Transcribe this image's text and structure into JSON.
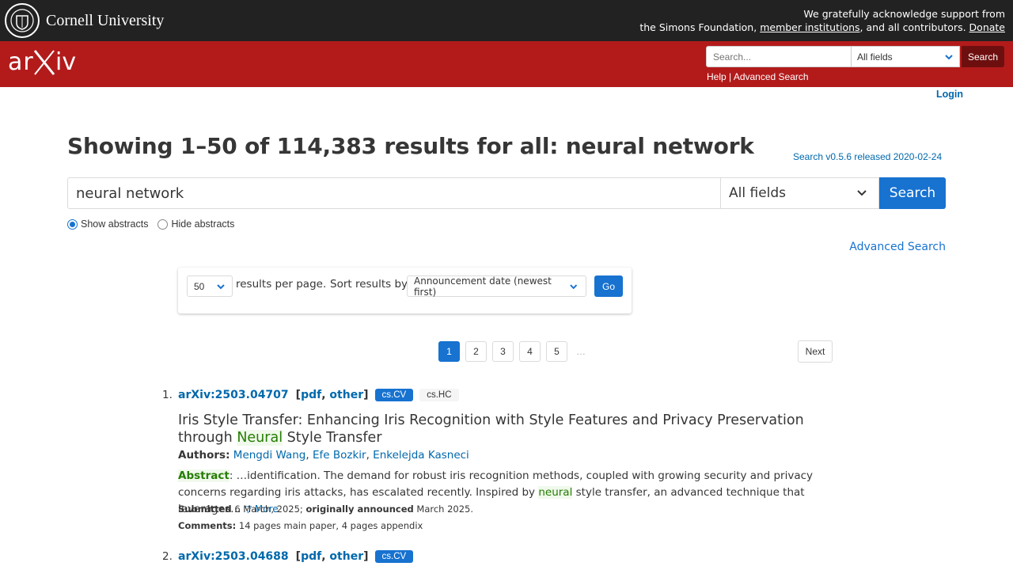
{
  "cornell": {
    "name": "Cornell University",
    "support_line1": "We gratefully acknowledge support from",
    "support_prefix": "the Simons Foundation,",
    "member_link": "member institutions",
    "support_mid": ", and all contributors.",
    "donate": "Donate"
  },
  "header": {
    "logo_text": "arXiv",
    "search_placeholder": "Search...",
    "field_value": "All fields",
    "search_button": "Search",
    "help": "Help",
    "separator": "|",
    "advanced": "Advanced Search",
    "login": "Login"
  },
  "page": {
    "title": "Showing 1–50 of 114,383 results for all: neural network",
    "version": "Search v0.5.6 released 2020-02-24",
    "query": "neural network",
    "field": "All fields",
    "search_button": "Search",
    "show_abstracts": "Show abstracts",
    "hide_abstracts": "Hide abstracts",
    "advanced_search": "Advanced Search"
  },
  "controls": {
    "per_page": "50",
    "per_page_label": "results per page.",
    "sort_label": "Sort results by",
    "sort_value": "Announcement date (newest first)",
    "go": "Go"
  },
  "pagination": {
    "pages": [
      "1",
      "2",
      "3",
      "4",
      "5"
    ],
    "ellipsis": "…",
    "next": "Next"
  },
  "results": [
    {
      "num": "1.",
      "id": "arXiv:2503.04707",
      "pdf": "pdf",
      "other": "other",
      "primary_tag": "cs.CV",
      "secondary_tag": "cs.HC",
      "title_pre": "Iris Style Transfer: Enhancing Iris Recognition with Style Features and Privacy Preservation through ",
      "title_hl": "Neural",
      "title_post": " Style Transfer",
      "authors_label": "Authors:",
      "authors": [
        "Mengdi Wang",
        "Efe Bozkir",
        "Enkelejda Kasneci"
      ],
      "abstract_label": "Abstract",
      "abstract_pre": ": …identification. The demand for robust iris recognition methods, coupled with growing security and privacy concerns regarding iris attacks, has escalated recently. Inspired by ",
      "abstract_hl": "neural",
      "abstract_post": " style transfer, an advanced technique that leverages… ",
      "more": "▽ More",
      "submitted_label": "Submitted",
      "submitted": "6 March, 2025;",
      "announced_label": "originally announced",
      "announced": "March 2025.",
      "comments_label": "Comments:",
      "comments": "14 pages main paper, 4 pages appendix"
    },
    {
      "num": "2.",
      "id": "arXiv:2503.04688",
      "pdf": "pdf",
      "other": "other",
      "primary_tag": "cs.CV"
    }
  ]
}
